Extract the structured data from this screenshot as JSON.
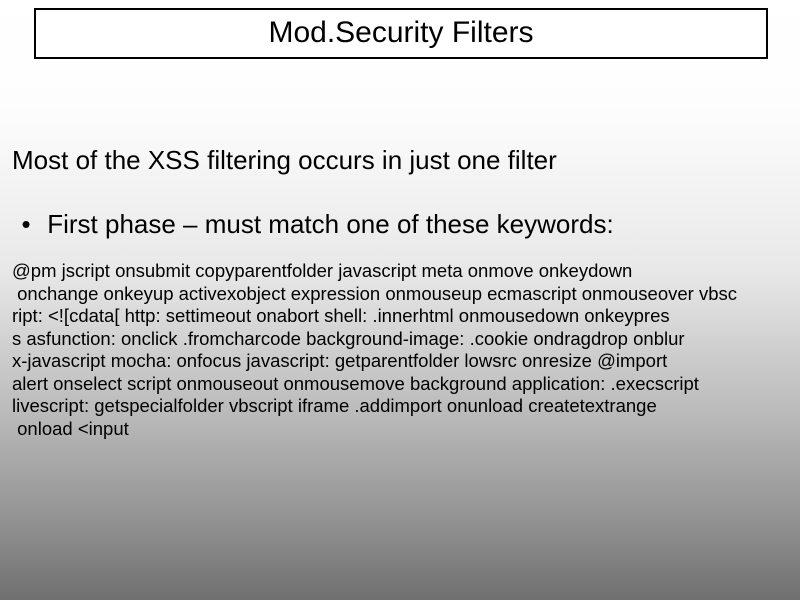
{
  "title": "Mod.Security Filters",
  "intro": "Most of the XSS filtering occurs in just one filter",
  "bullet": "First phase – must match one of these keywords:",
  "keywords_lines": [
    "@pm jscript onsubmit copyparentfolder javascript meta onmove onkeydown",
    " onchange onkeyup activexobject expression onmouseup ecmascript onmouseover vbsc",
    "ript: <![cdata[ http: settimeout onabort shell: .innerhtml onmousedown onkeypres",
    "s asfunction: onclick .fromcharcode background-image: .cookie ondragdrop onblur",
    "x-javascript mocha: onfocus javascript: getparentfolder lowsrc onresize @import",
    "alert onselect script onmouseout onmousemove background application: .execscript",
    "livescript: getspecialfolder vbscript iframe .addimport onunload createtextrange",
    " onload <input"
  ]
}
